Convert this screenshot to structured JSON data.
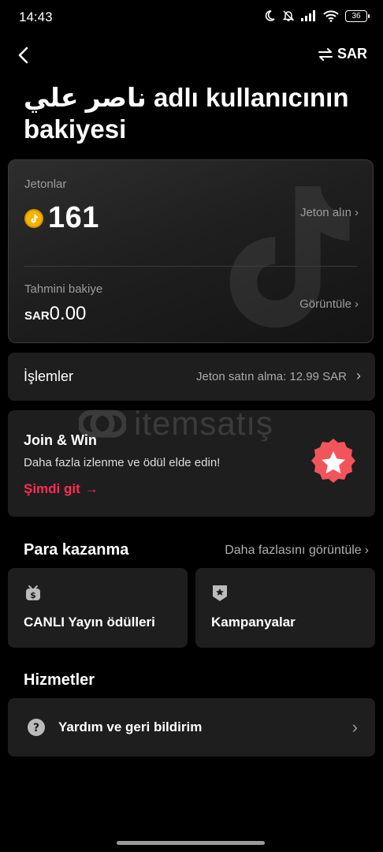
{
  "status_bar": {
    "time": "14:43",
    "battery": "36"
  },
  "header": {
    "currency": "SAR"
  },
  "title": "ناصر علي adlı kullanıcının bakiyesi",
  "balance_card": {
    "coins_label": "Jetonlar",
    "coins_value": "161",
    "get_coins_link": "Jeton alın",
    "estimated_label": "Tahmini bakiye",
    "estimated_prefix": "SAR",
    "estimated_amount": "0.00",
    "view_link": "Görüntüle"
  },
  "transactions": {
    "label": "İşlemler",
    "detail": "Jeton satın alma: 12.99 SAR"
  },
  "join_win": {
    "title": "Join & Win",
    "subtitle": "Daha fazla izlenme ve ödül elde edin!",
    "cta": "Şimdi git"
  },
  "watermark": {
    "brand": "itemsatış"
  },
  "monetization": {
    "title": "Para kazanma",
    "more_link": "Daha fazlasını görüntüle",
    "tiles": [
      {
        "label": "CANLI Yayın ödülleri",
        "icon": "live-gift-icon"
      },
      {
        "label": "Kampanyalar",
        "icon": "campaign-badge-icon"
      }
    ]
  },
  "services": {
    "title": "Hizmetler",
    "items": [
      {
        "label": "Yardım ve geri bildirim",
        "icon": "help-icon"
      }
    ]
  },
  "colors": {
    "accent": "#fe2c55",
    "coin": "#f4b400",
    "card": "#1e1e1e"
  }
}
